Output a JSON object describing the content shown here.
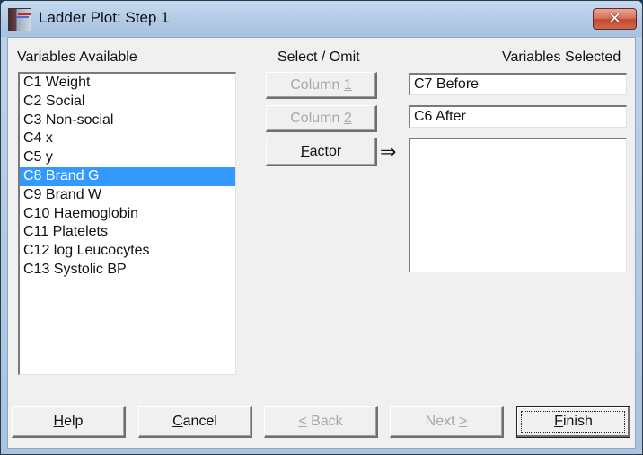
{
  "window": {
    "title": "Ladder Plot: Step 1",
    "close_glyph": "✕"
  },
  "available": {
    "label": "Variables Available",
    "items": [
      {
        "label": "C1 Weight",
        "selected": false
      },
      {
        "label": "C2 Social",
        "selected": false
      },
      {
        "label": "C3 Non-social",
        "selected": false
      },
      {
        "label": "C4 x",
        "selected": false
      },
      {
        "label": "C5 y",
        "selected": false
      },
      {
        "label": "C8 Brand G",
        "selected": true
      },
      {
        "label": "C9 Brand W",
        "selected": false
      },
      {
        "label": "C10 Haemoglobin",
        "selected": false
      },
      {
        "label": "C11 Platelets",
        "selected": false
      },
      {
        "label": "C12 log Leucocytes",
        "selected": false
      },
      {
        "label": "C13 Systolic BP",
        "selected": false
      }
    ]
  },
  "select_omit": {
    "label": "Select / Omit",
    "column1": {
      "prefix": "Column ",
      "mnemonic": "1",
      "suffix": "",
      "enabled": false
    },
    "column2": {
      "prefix": "Column ",
      "mnemonic": "2",
      "suffix": "",
      "enabled": false
    },
    "factor": {
      "prefix": "",
      "mnemonic": "F",
      "suffix": "actor",
      "enabled": true
    },
    "arrow_glyph": "⇒"
  },
  "selected": {
    "label": "Variables Selected",
    "column1_value": "C7 Before",
    "column2_value": "C6 After",
    "factor_items": []
  },
  "footer": {
    "help": {
      "prefix": "",
      "mnemonic": "H",
      "suffix": "elp",
      "enabled": true
    },
    "cancel": {
      "prefix": "",
      "mnemonic": "C",
      "suffix": "ancel",
      "enabled": true
    },
    "back": {
      "prefix": "",
      "mnemonic": "<",
      "suffix": " Back",
      "enabled": false
    },
    "next": {
      "prefix": "Next ",
      "mnemonic": ">",
      "suffix": "",
      "enabled": false
    },
    "finish": {
      "prefix": "",
      "mnemonic": "F",
      "suffix": "inish",
      "enabled": true,
      "default": true
    }
  }
}
